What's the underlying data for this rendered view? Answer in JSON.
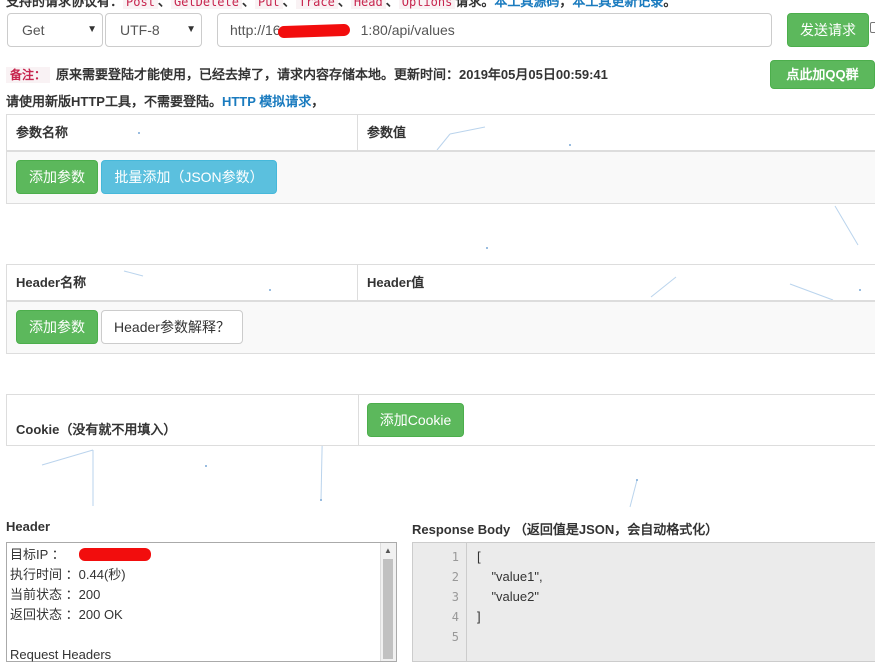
{
  "top_line": {
    "prefix": "支持的请求协议有：",
    "methods": [
      "Post",
      "GetDelete",
      "Put",
      "Trace",
      "Head",
      "Options"
    ],
    "suffix": "请求。",
    "link1": "本工具源码",
    "link2": "本工具更新记录"
  },
  "request": {
    "method": "Get",
    "encoding": "UTF-8",
    "url_prefix": "http://16",
    "url_suffix": "1:80/api/values",
    "send_label": "发送请求"
  },
  "qq_button": "点此加QQ群",
  "notice": {
    "tag": "备注：",
    "text": "原来需要登陆才能使用，已经去掉了，请求内容存储本地。更新时间：2019年05月05日00:59:41",
    "line2_text": "请使用新版HTTP工具，不需要登陆。",
    "line2_link": "HTTP 模拟请求",
    "line2_tail": "，"
  },
  "params_table": {
    "col1": "参数名称",
    "col2": "参数值",
    "add_label": "添加参数",
    "batch_label": "批量添加（JSON参数）"
  },
  "header_table": {
    "col1": "Header名称",
    "col2": "Header值",
    "add_label": "添加参数",
    "explain_label": "Header参数解释？"
  },
  "cookie": {
    "label": "Cookie（没有就不用填入）",
    "add_label": "添加Cookie"
  },
  "response_header": {
    "title": "Header",
    "lines": [
      {
        "key": "目标IP",
        "value": "："
      },
      {
        "key": "执行时间",
        "value": "：0.44(秒)"
      },
      {
        "key": "当前状态",
        "value": "：200"
      },
      {
        "key": "返回状态",
        "value": "：200  OK"
      }
    ],
    "partial_line": "Request Headers"
  },
  "response_body": {
    "title": "Response Body （返回值是JSON，会自动格式化）",
    "line_numbers": [
      "1",
      "2",
      "3",
      "4",
      "5"
    ],
    "lines": [
      "[",
      "    \"value1\",",
      "    \"value2\"",
      "]",
      ""
    ]
  },
  "colors": {
    "green": "#5cb85c",
    "blue": "#5bc0de",
    "link": "#1a7bbf",
    "tag_red": "#c7254e"
  }
}
